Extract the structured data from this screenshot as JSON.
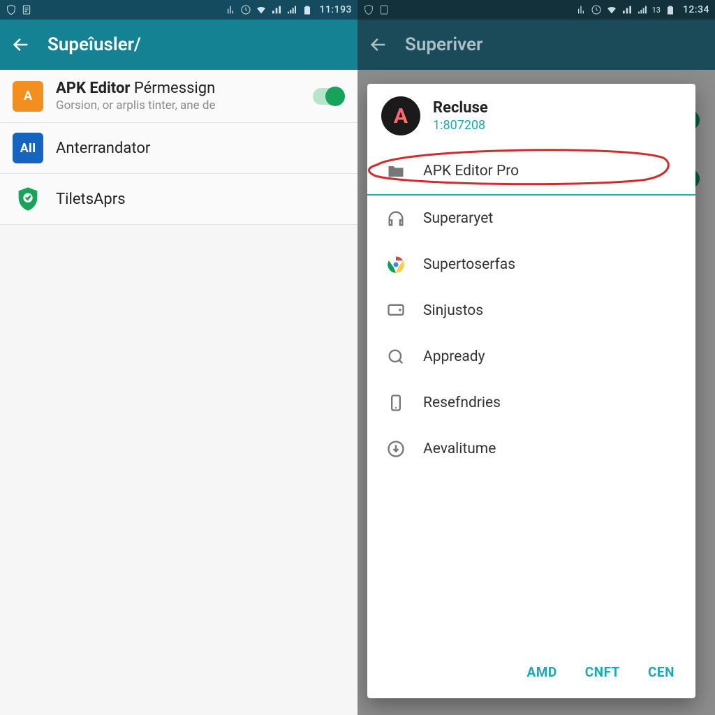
{
  "left": {
    "status": {
      "time": "11:193"
    },
    "appbar": {
      "title": "Supeîusler/"
    },
    "rows": [
      {
        "icon": "A",
        "titleBold": "APK Editor",
        "titleRest": " Pérmessign",
        "sub": "Gorsion, or arplis tinter, ane de",
        "toggle": true
      },
      {
        "icon": "AII",
        "title": "Anterrandator"
      },
      {
        "icon": "shield",
        "title": "TiletsAprs"
      }
    ]
  },
  "right": {
    "status": {
      "time": "12:34",
      "batt": "13"
    },
    "appbar": {
      "title": "Superiver"
    },
    "dialog": {
      "avatarLetter": "A",
      "name": "Recluse",
      "version": "1:807208",
      "items": [
        {
          "icon": "folder",
          "label": "APK Editor Pro",
          "selected": true
        },
        {
          "icon": "headphones",
          "label": "Superaryet"
        },
        {
          "icon": "chrome",
          "label": "Supertoserfas"
        },
        {
          "icon": "monitor",
          "label": "Sinjustos"
        },
        {
          "icon": "search",
          "label": "Appready"
        },
        {
          "icon": "phone",
          "label": "Resefndries"
        },
        {
          "icon": "download",
          "label": "Aevalitume"
        }
      ],
      "actions": [
        "AMD",
        "CNFT",
        "CEN"
      ]
    }
  }
}
